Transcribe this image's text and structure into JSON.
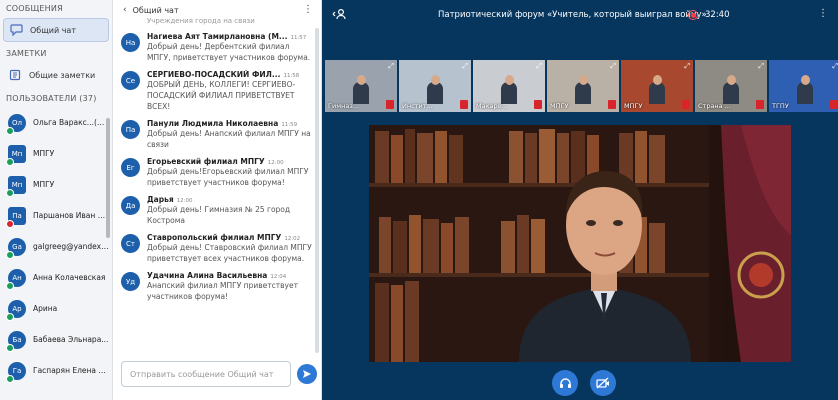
{
  "sidebar": {
    "messages_title": "СООБЩЕНИЯ",
    "public_chat_label": "Общий чат",
    "notes_title": "ЗАМЕТКИ",
    "shared_notes_label": "Общие заметки",
    "users_title": "ПОЛЬЗОВАТЕЛИ (37)",
    "users": [
      {
        "initials": "Ол",
        "name": "Ольга Варакс...(Вы)",
        "status": "green"
      },
      {
        "initials": "Мп",
        "name": "МПГУ",
        "status": "green",
        "square": true
      },
      {
        "initials": "Мп",
        "name": "МПГУ",
        "status": "green",
        "square": true
      },
      {
        "initials": "Па",
        "name": "Паршанов Иван А...",
        "status": "red",
        "square": true
      },
      {
        "initials": "Ga",
        "name": "galgreeg@yandex.ru",
        "status": "green"
      },
      {
        "initials": "Ан",
        "name": "Анна Колачевская",
        "status": "green"
      },
      {
        "initials": "Ар",
        "name": "Арина",
        "status": "green"
      },
      {
        "initials": "Ба",
        "name": "Бабаева Эльнара...",
        "status": "green"
      },
      {
        "initials": "Га",
        "name": "Гаспарян Елена в...",
        "status": "green"
      }
    ]
  },
  "chat": {
    "title": "Общий чат",
    "back_icon": "chevron-left-icon",
    "cut_text": "Учреждения города на связи",
    "messages": [
      {
        "initials": "На",
        "author": "Нагиева Аят Тамирлановна (М...",
        "time": "11:57",
        "text": "Добрый день! Дербентский филиал МПГУ, приветствует участников форума."
      },
      {
        "initials": "Се",
        "author": "СЕРГИЕВО-ПОСАДСКИЙ ФИЛ...",
        "time": "11:58",
        "text": "ДОБРЫЙ ДЕНЬ, КОЛЛЕГИ! СЕРГИЕВО-ПОСАДСКИЙ ФИЛИАЛ ПРИВЕТСТВУЕТ ВСЕХ!"
      },
      {
        "initials": "Па",
        "author": "Панули Людмила Николаевна",
        "time": "11:59",
        "text": "Добрый день! Анапский филиал МПГУ на связи"
      },
      {
        "initials": "Ег",
        "author": "Егорьевский филиал МПГУ",
        "time": "12:00",
        "text": "Добрый день!Егорьевский филиал МПГУ приветствует участников форума!"
      },
      {
        "initials": "Да",
        "author": "Дарья",
        "time": "12:00",
        "text": "Добрый день! Гимназия № 25 город Кострома"
      },
      {
        "initials": "Ст",
        "author": "Ставропольский филиал МПГУ",
        "time": "12:02",
        "text": "Добрый день! Ставровский филиал МПГУ приветствует всех участников форума."
      },
      {
        "initials": "Уд",
        "author": "Удачина Алина Васильевна",
        "time": "12:04",
        "text": "Анапский филиал МПГУ приветствует участников форума!"
      }
    ],
    "input_placeholder": "Отправить сообщение Общий чат"
  },
  "conference": {
    "title": "Патриотический форум «Учитель, который выиграл войну»",
    "recording_time": "32:40"
  },
  "thumbnails": [
    {
      "caption": "Гимназ...",
      "color": "#9aa3ad"
    },
    {
      "caption": "Инстит...",
      "color": "#b7c2cf"
    },
    {
      "caption": "Макаре...",
      "color": "#c9cdd2"
    },
    {
      "caption": "МПГУ",
      "color": "#b9b0a6"
    },
    {
      "caption": "МПГУ",
      "color": "#a8482f"
    },
    {
      "caption": "Страна ...",
      "color": "#8e8a84"
    },
    {
      "caption": "ТГПУ",
      "color": "#2f5fb2"
    }
  ],
  "colors": {
    "accent": "#2e79d6",
    "main_bg": "#06365e",
    "recording": "#ff3b3b"
  }
}
